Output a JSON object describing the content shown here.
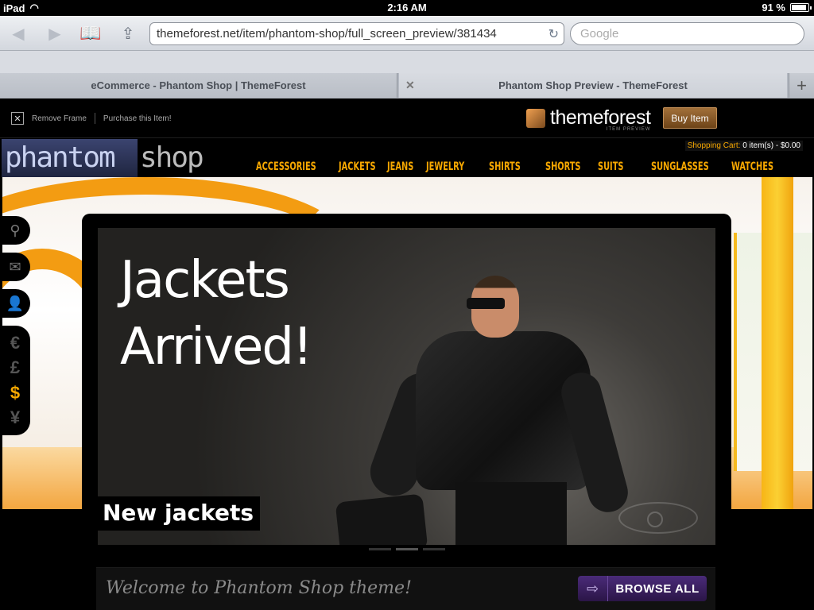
{
  "status_bar": {
    "device": "iPad",
    "time": "2:16 AM",
    "battery_text": "91 %",
    "battery_level": 0.91
  },
  "browser": {
    "url": "themeforest.net/item/phantom-shop/full_screen_preview/381434",
    "search_placeholder": "Google",
    "tabs": [
      {
        "label": "eCommerce - Phantom Shop | ThemeForest"
      },
      {
        "label": "Phantom Shop Preview - ThemeForest"
      }
    ],
    "new_tab_label": "+"
  },
  "frame_bar": {
    "remove_frame": "Remove Frame",
    "purchase": "Purchase this Item!",
    "brand": "themeforest",
    "brand_sub": "ITEM PREVIEW",
    "buy_label": "Buy Item"
  },
  "site": {
    "logo_left": "phantom",
    "logo_right": "shop",
    "cart_label": "Shopping Cart:",
    "cart_value": "0 item(s) - $0.00",
    "menu": [
      "ACCESSORIES",
      "JACKETS",
      "JEANS",
      "JEWELRY",
      "SHIRTS",
      "SHORTS",
      "SUITS",
      "SUNGLASSES",
      "WATCHES"
    ],
    "currencies": [
      "€",
      "£",
      "$",
      "¥"
    ],
    "active_currency": "$"
  },
  "slider": {
    "headline_line1": "Jackets",
    "headline_line2": "Arrived!",
    "caption": "New jackets",
    "slide_count": 3,
    "active_slide": 2
  },
  "welcome": {
    "text": "Welcome to Phantom Shop theme!",
    "browse_label": "BROWSE ALL"
  },
  "colors": {
    "accent_orange": "#f7a800",
    "browse_purple": "#3d2466",
    "buy_brown": "#8a5a2a"
  }
}
